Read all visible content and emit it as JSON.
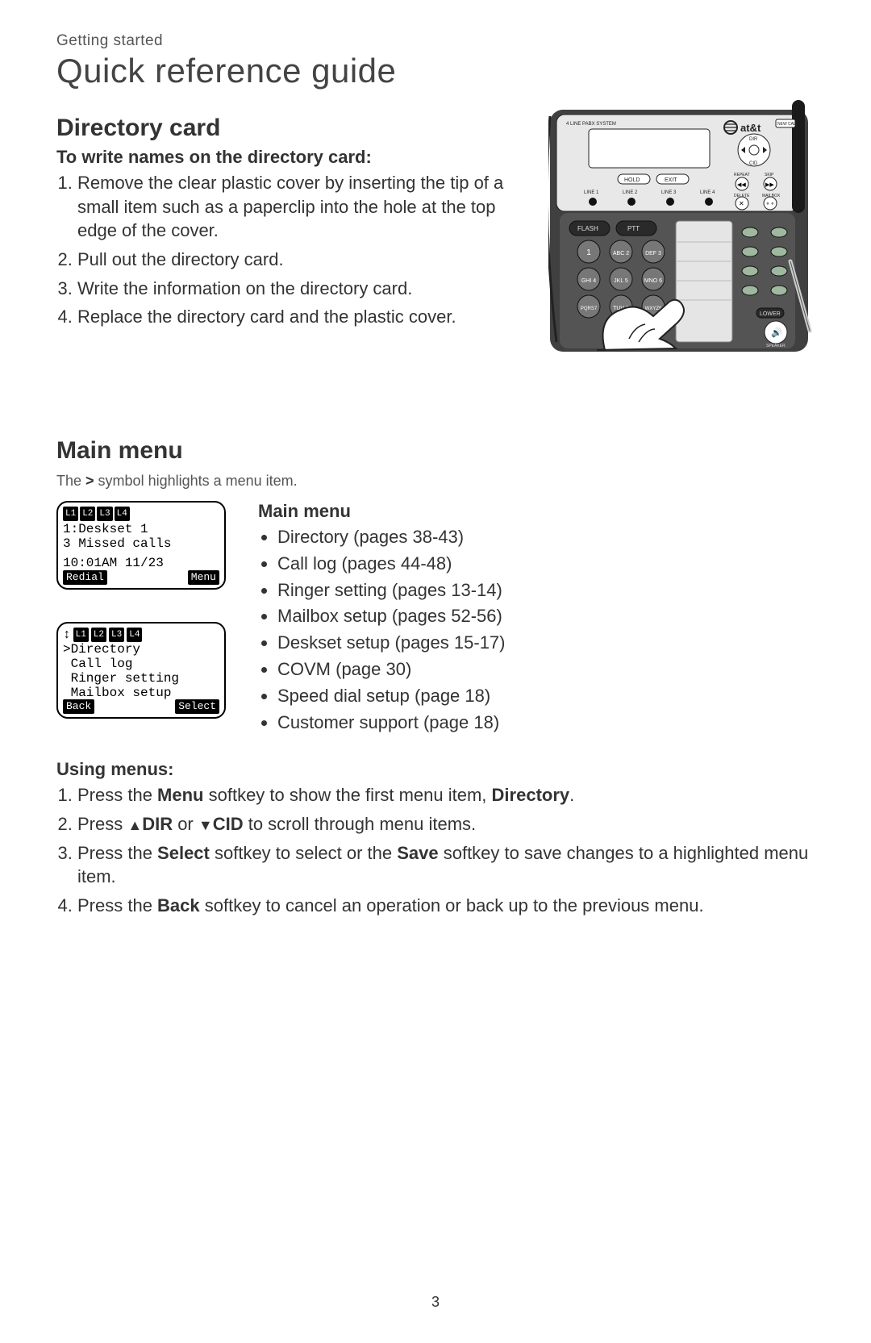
{
  "breadcrumb": "Getting started",
  "page_title": "Quick reference guide",
  "directory_card": {
    "heading": "Directory card",
    "sub": "To write names on the directory card:",
    "steps": [
      "Remove the clear plastic cover by inserting the tip of a small item such as a paperclip into the hole at the top edge of the cover.",
      "Pull out the directory card.",
      "Write the information on the directory card.",
      "Replace the directory card and the plastic cover."
    ]
  },
  "phone_illustration": {
    "brand": "at&t",
    "label_system": "4 LINE PABX SYSTEM",
    "btn_newcall": "NEW CALL",
    "nav_dir": "DIR",
    "nav_cid": "CID",
    "lbl_repeat": "REPEAT",
    "lbl_skip": "SKIP",
    "lbl_delete": "DELETE",
    "lbl_mailbox": "MAILBOX",
    "btn_hold": "HOLD",
    "btn_exit": "EXIT",
    "line_labels": [
      "LINE 1",
      "LINE 2",
      "LINE 3",
      "LINE 4"
    ],
    "btn_flash": "FLASH",
    "btn_ptt": "PTT",
    "lbl_lower": "LOWER",
    "lbl_speaker": "SPEAKER",
    "keypad": [
      "1",
      "ABC 2",
      "DEF 3",
      "GHI 4",
      "JKL 5",
      "MNO 6",
      "PQRS 7",
      "TUV 8",
      "WXYZ 9"
    ]
  },
  "main_menu": {
    "heading": "Main menu",
    "note_pre": "The ",
    "note_sym": ">",
    "note_post": " symbol highlights a menu item.",
    "col_heading": "Main menu",
    "items": [
      "Directory (pages 38-43)",
      "Call log (pages 44-48)",
      "Ringer setting (pages 13-14)",
      "Mailbox setup (pages 52-56)",
      "Deskset setup (pages 15-17)",
      "COVM (page 30)",
      "Speed dial setup (page 18)",
      "Customer support (page 18)"
    ]
  },
  "lcd1": {
    "tabs": [
      "L1",
      "L2",
      "L3",
      "L4"
    ],
    "line1": "1:Deskset 1",
    "line2": "3 Missed calls",
    "line3": "10:01AM 11/23",
    "soft_left": "Redial",
    "soft_right": "Menu"
  },
  "lcd2": {
    "arrow": "↕",
    "tabs": [
      "L1",
      "L2",
      "L3",
      "L4"
    ],
    "line1": ">Directory",
    "line2": " Call log",
    "line3": " Ringer setting",
    "line4": " Mailbox setup",
    "soft_left": "Back",
    "soft_right": "Select"
  },
  "using_menus": {
    "heading": "Using menus:",
    "step1_a": "Press the ",
    "step1_b": "Menu",
    "step1_c": " softkey to show the first menu item, ",
    "step1_d": "Directory",
    "step1_e": ".",
    "step2_a": "Press ",
    "step2_b": "DIR",
    "step2_c": " or ",
    "step2_d": "CID",
    "step2_e": " to scroll through menu items.",
    "step3_a": "Press the ",
    "step3_b": "Select",
    "step3_c": " softkey to select or the ",
    "step3_d": "Save",
    "step3_e": " softkey to save changes to a highlighted menu item.",
    "step4_a": "Press the ",
    "step4_b": "Back",
    "step4_c": " softkey to cancel an operation or back up to the previous menu."
  },
  "page_number": "3"
}
